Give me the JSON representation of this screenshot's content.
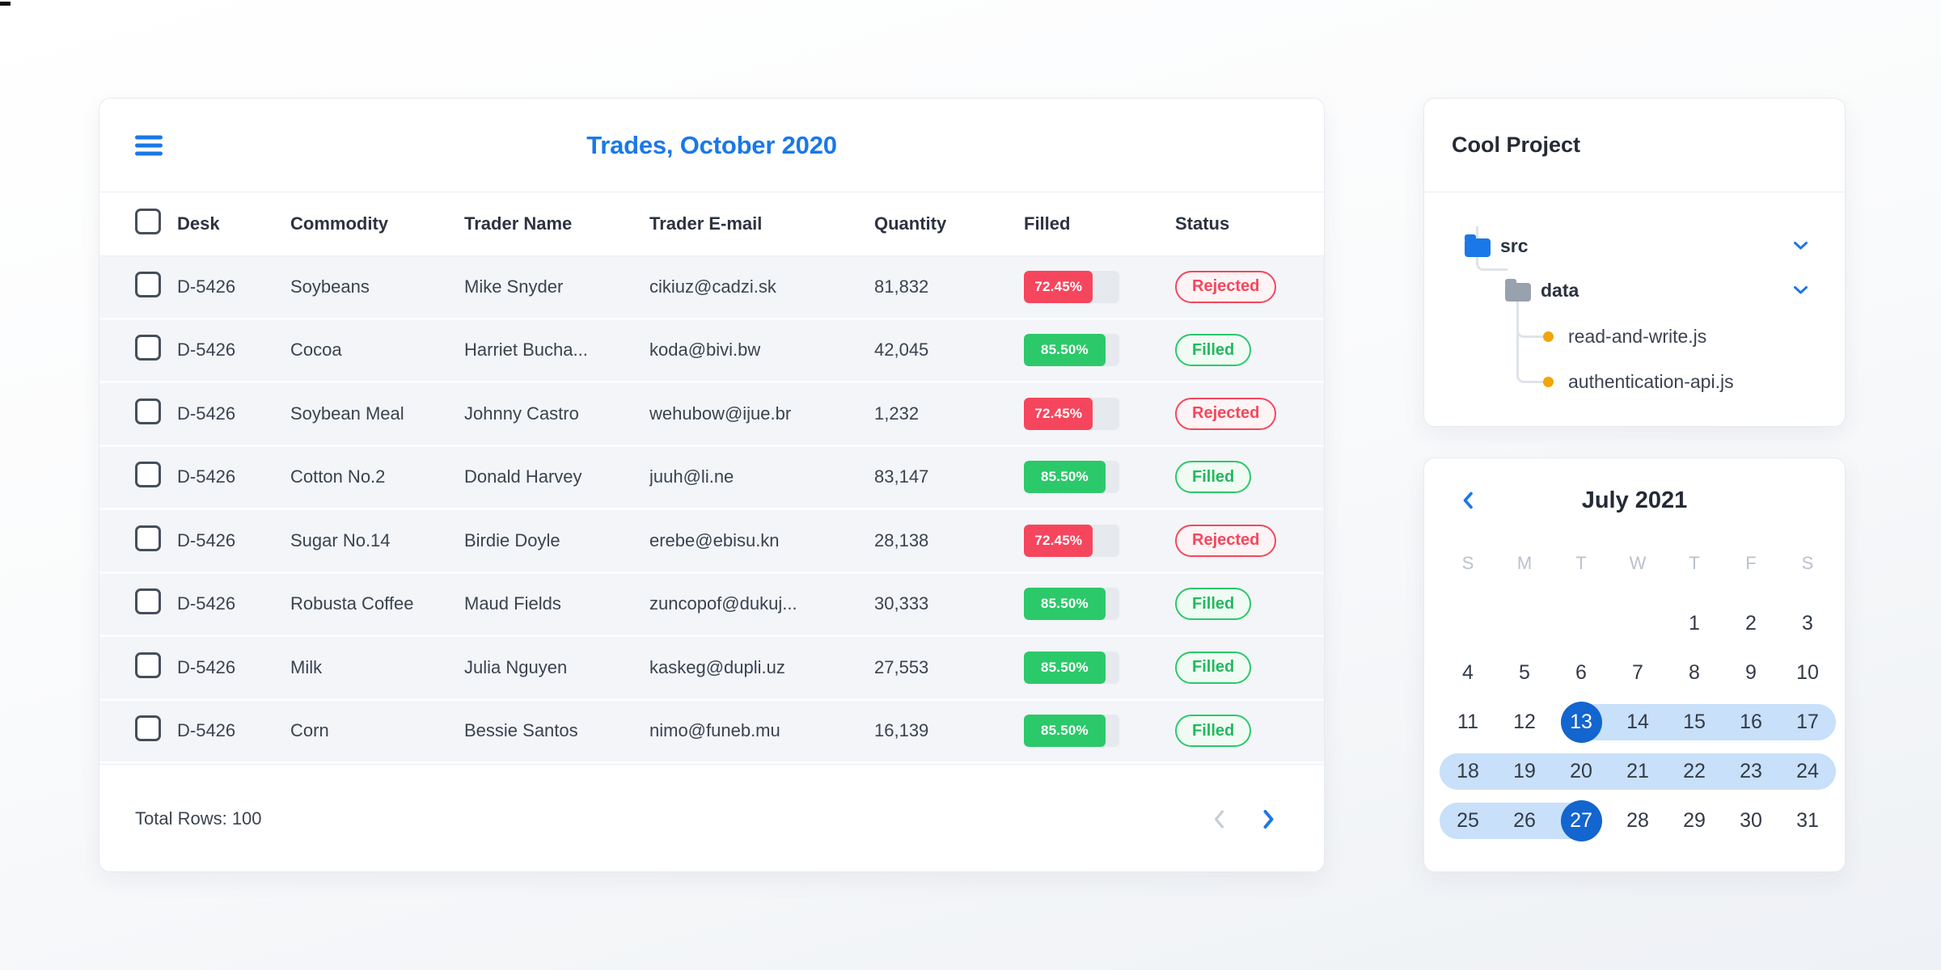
{
  "colors": {
    "accent_blue": "#1a78e8",
    "selected_day_blue": "#1365cf",
    "range_light_blue": "#c8e0f9",
    "status_red": "#f6465d",
    "status_green": "#2bc96a",
    "file_dot_orange": "#f0a50a"
  },
  "table_card": {
    "title": "Trades, October 2020",
    "columns": [
      "Desk",
      "Commodity",
      "Trader Name",
      "Trader E-mail",
      "Quantity",
      "Filled",
      "Status"
    ],
    "rows": [
      {
        "desk": "D-5426",
        "commodity": "Soybeans",
        "trader_name": "Mike Snyder",
        "trader_email": "cikiuz@cadzi.sk",
        "quantity": "81,832",
        "filled_label": "72.45%",
        "filled_pct": 72.45,
        "filled_color": "red",
        "status": "Rejected",
        "status_variant": "rejected"
      },
      {
        "desk": "D-5426",
        "commodity": "Cocoa",
        "trader_name": "Harriet Bucha...",
        "trader_email": "koda@bivi.bw",
        "quantity": "42,045",
        "filled_label": "85.50%",
        "filled_pct": 85.5,
        "filled_color": "green",
        "status": "Filled",
        "status_variant": "filled"
      },
      {
        "desk": "D-5426",
        "commodity": "Soybean Meal",
        "trader_name": "Johnny Castro",
        "trader_email": "wehubow@ijue.br",
        "quantity": "1,232",
        "filled_label": "72.45%",
        "filled_pct": 72.45,
        "filled_color": "red",
        "status": "Rejected",
        "status_variant": "rejected"
      },
      {
        "desk": "D-5426",
        "commodity": "Cotton No.2",
        "trader_name": "Donald Harvey",
        "trader_email": "juuh@li.ne",
        "quantity": "83,147",
        "filled_label": "85.50%",
        "filled_pct": 85.5,
        "filled_color": "green",
        "status": "Filled",
        "status_variant": "filled"
      },
      {
        "desk": "D-5426",
        "commodity": "Sugar No.14",
        "trader_name": "Birdie Doyle",
        "trader_email": "erebe@ebisu.kn",
        "quantity": "28,138",
        "filled_label": "72.45%",
        "filled_pct": 72.45,
        "filled_color": "red",
        "status": "Rejected",
        "status_variant": "rejected"
      },
      {
        "desk": "D-5426",
        "commodity": "Robusta Coffee",
        "trader_name": "Maud Fields",
        "trader_email": "zuncopof@dukuj...",
        "quantity": "30,333",
        "filled_label": "85.50%",
        "filled_pct": 85.5,
        "filled_color": "green",
        "status": "Filled",
        "status_variant": "filled"
      },
      {
        "desk": "D-5426",
        "commodity": "Milk",
        "trader_name": "Julia Nguyen",
        "trader_email": "kaskeg@dupli.uz",
        "quantity": "27,553",
        "filled_label": "85.50%",
        "filled_pct": 85.5,
        "filled_color": "green",
        "status": "Filled",
        "status_variant": "filled"
      },
      {
        "desk": "D-5426",
        "commodity": "Corn",
        "trader_name": "Bessie Santos",
        "trader_email": "nimo@funeb.mu",
        "quantity": "16,139",
        "filled_label": "85.50%",
        "filled_pct": 85.5,
        "filled_color": "green",
        "status": "Filled",
        "status_variant": "filled"
      }
    ],
    "footer": {
      "total_label": "Total Rows: 100"
    }
  },
  "file_tree_card": {
    "title": "Cool Project",
    "nodes": [
      {
        "type": "folder",
        "label": "src",
        "depth": 0,
        "color": "blue",
        "expanded": true
      },
      {
        "type": "folder",
        "label": "data",
        "depth": 1,
        "color": "gray",
        "expanded": true
      },
      {
        "type": "file",
        "label": "read-and-write.js",
        "depth": 2
      },
      {
        "type": "file",
        "label": "authentication-api.js",
        "depth": 2
      }
    ]
  },
  "calendar_card": {
    "title": "July 2021",
    "weekdays": [
      "S",
      "M",
      "T",
      "W",
      "T",
      "F",
      "S"
    ],
    "weeks": [
      [
        null,
        null,
        null,
        null,
        1,
        2,
        3
      ],
      [
        4,
        5,
        6,
        7,
        8,
        9,
        10
      ],
      [
        11,
        12,
        13,
        14,
        15,
        16,
        17
      ],
      [
        18,
        19,
        20,
        21,
        22,
        23,
        24
      ],
      [
        25,
        26,
        27,
        28,
        29,
        30,
        31
      ]
    ],
    "range_start": 13,
    "range_end": 27
  }
}
